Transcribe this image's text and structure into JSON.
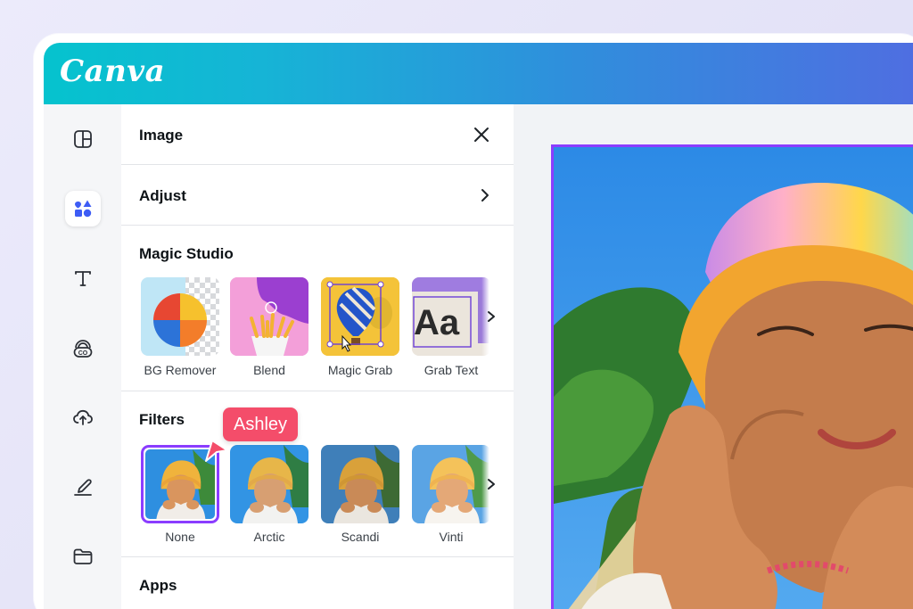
{
  "app": {
    "logo": "Canva"
  },
  "panel": {
    "header": {
      "title": "Image"
    },
    "adjust": {
      "label": "Adjust"
    },
    "magic_studio": {
      "title": "Magic Studio",
      "items": [
        {
          "label": "BG Remover"
        },
        {
          "label": "Blend"
        },
        {
          "label": "Magic Grab"
        },
        {
          "label": "Grab Text"
        }
      ]
    },
    "filters": {
      "title": "Filters",
      "items": [
        {
          "label": "None",
          "selected": true
        },
        {
          "label": "Arctic"
        },
        {
          "label": "Scandi"
        },
        {
          "label": "Vinti"
        }
      ]
    },
    "apps": {
      "title": "Apps"
    }
  },
  "collaborator": {
    "name": "Ashley",
    "color": "#f44d6a"
  },
  "colors": {
    "accent": "#8b3dff",
    "brand_start": "#05c3ce",
    "brand_end": "#4f6ee1"
  },
  "sidebar_icons": [
    "layout-icon",
    "elements-icon",
    "text-icon",
    "brand-icon",
    "upload-icon",
    "draw-icon",
    "folder-icon"
  ]
}
